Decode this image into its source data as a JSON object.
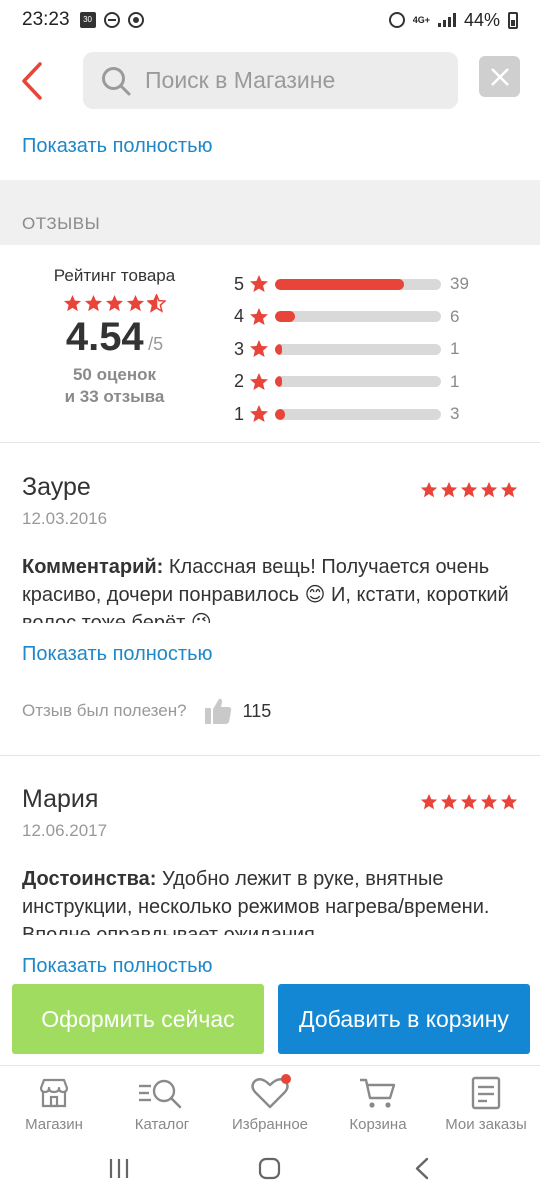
{
  "status_bar": {
    "time": "23:23",
    "calendar_day": "30",
    "network": "4G+",
    "battery": "44%"
  },
  "header": {
    "search_placeholder": "Поиск в Магазине"
  },
  "description": {
    "show_full": "Показать полностью"
  },
  "reviews_section": {
    "title": "ОТЗЫВЫ",
    "rating_title": "Рейтинг товара",
    "average": "4.54",
    "max": "/5",
    "ratings_count": "50 оценок",
    "reviews_count": "и 33 отзыва",
    "star_fill": 0.908,
    "breakdown": [
      {
        "stars": "5",
        "count": "39",
        "fraction": 0.78
      },
      {
        "stars": "4",
        "count": "6",
        "fraction": 0.12
      },
      {
        "stars": "3",
        "count": "1",
        "fraction": 0.02
      },
      {
        "stars": "2",
        "count": "1",
        "fraction": 0.02
      },
      {
        "stars": "1",
        "count": "3",
        "fraction": 0.06
      }
    ]
  },
  "reviews": [
    {
      "author": "Зауре",
      "date": "12.03.2016",
      "rating": 5,
      "label": "Комментарий:",
      "text": " Классная вещь! Получается очень красиво, дочери понравилось 😊 И, кстати, короткий волос тоже берёт 😉",
      "show_full": "Показать полностью",
      "helpful_label": "Отзыв был полезен?",
      "helpful_count": "115"
    },
    {
      "author": "Мария",
      "date": "12.06.2017",
      "rating": 5,
      "label": "Достоинства:",
      "text": " Удобно лежит в руке, внятные инструкции, несколько режимов нагрева/времени. Вполне оправдывает ожидания....",
      "show_full": "Показать полностью"
    }
  ],
  "actions": {
    "order_now": "Оформить сейчас",
    "add_to_cart": "Добавить в корзину"
  },
  "tabs": [
    {
      "label": "Магазин",
      "icon": "store-icon"
    },
    {
      "label": "Каталог",
      "icon": "catalog-search-icon"
    },
    {
      "label": "Избранное",
      "icon": "heart-icon"
    },
    {
      "label": "Корзина",
      "icon": "cart-icon"
    },
    {
      "label": "Мои заказы",
      "icon": "orders-icon"
    }
  ],
  "colors": {
    "accent_red": "#e8443a",
    "link_blue": "#1e88c8",
    "order_green": "#9fdc5f",
    "cart_blue": "#1487d4"
  }
}
